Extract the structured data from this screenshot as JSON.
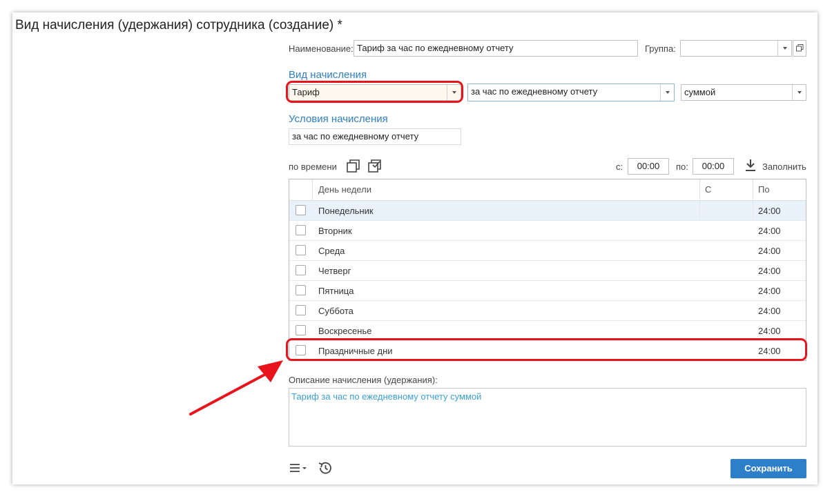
{
  "title": "Вид начисления (удержания) сотрудника (создание) *",
  "naim": {
    "label": "Наименование:",
    "value": "Тариф за час по ежедневному отчету"
  },
  "group": {
    "label": "Группа:",
    "value": ""
  },
  "vid": {
    "section": "Вид начисления",
    "type": "Тариф",
    "basis": "за час по ежедневному отчету",
    "mode": "суммой"
  },
  "conditions": {
    "section": "Условия начисления",
    "value": "за час по ежедневному отчету"
  },
  "toolbar": {
    "by_time": "по времени",
    "from_label": "с:",
    "from_value": "00:00",
    "to_label": "по:",
    "to_value": "00:00",
    "fill_label": "Заполнить"
  },
  "table": {
    "columns": [
      "День недели",
      "С",
      "По"
    ],
    "rows": [
      {
        "day": "Понедельник",
        "from": "",
        "to": "24:00",
        "selected": true
      },
      {
        "day": "Вторник",
        "from": "",
        "to": "24:00",
        "selected": false
      },
      {
        "day": "Среда",
        "from": "",
        "to": "24:00",
        "selected": false
      },
      {
        "day": "Четверг",
        "from": "",
        "to": "24:00",
        "selected": false
      },
      {
        "day": "Пятница",
        "from": "",
        "to": "24:00",
        "selected": false
      },
      {
        "day": "Суббота",
        "from": "",
        "to": "24:00",
        "selected": false
      },
      {
        "day": "Воскресенье",
        "from": "",
        "to": "24:00",
        "selected": false
      },
      {
        "day": "Праздничные дни",
        "from": "",
        "to": "24:00",
        "selected": false
      }
    ]
  },
  "description": {
    "label": "Описание начисления (удержания):",
    "value": "Тариф за час по ежедневному отчету суммой"
  },
  "footer": {
    "save_label": "Сохранить"
  },
  "icons": {
    "menu": "menu-icon",
    "history": "history-icon",
    "copy": "copy-icon",
    "check_all": "check-all-icon",
    "download": "download-icon",
    "open": "open-window-icon"
  },
  "colors": {
    "accent": "#2e7fc9",
    "highlight": "#e8141c",
    "selected_row": "#e9f1fa",
    "section_title": "#2d7fc6"
  }
}
